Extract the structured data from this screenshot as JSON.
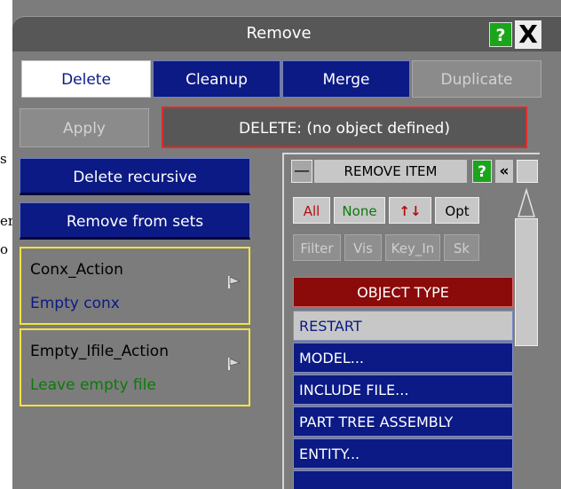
{
  "background_fragments": [
    "s",
    "er",
    "o"
  ],
  "window": {
    "title": "Remove",
    "help_label": "?",
    "close_label": "X"
  },
  "tabs": [
    {
      "label": "Delete",
      "state": "active"
    },
    {
      "label": "Cleanup",
      "state": "normal"
    },
    {
      "label": "Merge",
      "state": "normal"
    },
    {
      "label": "Duplicate",
      "state": "disabled"
    }
  ],
  "apply_label": "Apply",
  "status_text": "DELETE: (no object defined)",
  "buttons": {
    "delete_recursive": "Delete recursive",
    "remove_from_sets": "Remove from sets"
  },
  "actions": [
    {
      "title": "Conx_Action",
      "value": "Empty conx",
      "value_color": "#0b1a84"
    },
    {
      "title": "Empty_Ifile_Action",
      "value": "Leave empty file",
      "value_color": "#0a7a0a"
    }
  ],
  "remove_item": {
    "dash_label": "—",
    "title": "REMOVE ITEM",
    "help_label": "?",
    "collapse_label": "«",
    "row1": {
      "all": "All",
      "none": "None",
      "arrows": "↑↓",
      "opt": "Opt"
    },
    "row2": {
      "filter": "Filter",
      "vis": "Vis",
      "key_in": "Key_In",
      "sk": "Sk"
    },
    "object_type_header": "OBJECT TYPE",
    "items": [
      "RESTART",
      "MODEL...",
      "INCLUDE FILE...",
      "PART TREE ASSEMBLY",
      "ENTITY..."
    ]
  },
  "colors": {
    "panel_bg": "#7c7c7c",
    "accent_blue": "#0b1a84",
    "help_green": "#1aa51a",
    "status_border": "#e22a2a",
    "action_border": "#f3e343",
    "object_type_red": "#8b0a0a"
  }
}
